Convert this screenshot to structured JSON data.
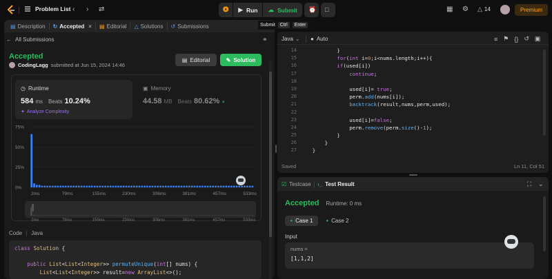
{
  "topbar": {
    "problem_list": "Problem List",
    "run": "Run",
    "submit": "Submit",
    "streak": "14",
    "premium": "Premium",
    "tooltip": {
      "label": "Submit",
      "key1": "Ctrl",
      "key2": "Enter"
    }
  },
  "tabs": [
    {
      "label": "Description"
    },
    {
      "label": "Accepted"
    },
    {
      "label": "Editorial"
    },
    {
      "label": "Solutions"
    },
    {
      "label": "Submissions"
    }
  ],
  "submission": {
    "back_label": "All Submissions",
    "status": "Accepted",
    "user": "CodingLagg",
    "submitted_text": "submitted at Jun 15, 2024 14:46",
    "editorial_btn": "Editorial",
    "solution_btn": "Solution"
  },
  "runtime": {
    "title": "Runtime",
    "value": "584",
    "unit": "ms",
    "beats_label": "Beats",
    "beats_value": "10.24%",
    "analyze": "Analyze Complexity"
  },
  "memory": {
    "title": "Memory",
    "value": "44.58",
    "unit": "MB",
    "beats_label": "Beats",
    "beats_value": "80.62%"
  },
  "chart_data": {
    "type": "bar",
    "ytick_labels": [
      "75%",
      "50%",
      "25%",
      "0%"
    ],
    "yticks": [
      75,
      50,
      25,
      0
    ],
    "ylim": [
      0,
      75
    ],
    "xtick_labels": [
      "2ms",
      "79ms",
      "155ms",
      "230ms",
      "306ms",
      "381ms",
      "457ms",
      "533ms"
    ],
    "xlim": [
      0,
      560
    ],
    "values": [
      66,
      5,
      3,
      3,
      2,
      2,
      2,
      2,
      2,
      2,
      2,
      2,
      2,
      2,
      2,
      2,
      2,
      2,
      2,
      2,
      2,
      2,
      2,
      2,
      2,
      2,
      2,
      2,
      2,
      2,
      2,
      2,
      2,
      2,
      2,
      2,
      2,
      2,
      2,
      2,
      2,
      2,
      2,
      2,
      2,
      2,
      2,
      2,
      2,
      2,
      2,
      2,
      2,
      2,
      2,
      2,
      2,
      2,
      2,
      2,
      2,
      2,
      2,
      2,
      2,
      2,
      2,
      2,
      2,
      2,
      2,
      2,
      2,
      2,
      2,
      2,
      2,
      2,
      2,
      2,
      2,
      2,
      2,
      2,
      2
    ],
    "colors": {
      "bar": "#3b82f6",
      "highlight": "#60a5fa"
    },
    "grid": true
  },
  "left_code": {
    "header_label": "Code",
    "lang": "Java",
    "lines": [
      [
        [
          "class ",
          "kw"
        ],
        [
          "Solution ",
          "ty"
        ],
        [
          "{",
          "id"
        ]
      ],
      [
        [
          "",
          "id"
        ]
      ],
      [
        [
          "    public ",
          "kw"
        ],
        [
          "List",
          "ty"
        ],
        [
          "<",
          "id"
        ],
        [
          "List",
          "ty"
        ],
        [
          "<",
          "id"
        ],
        [
          "Integer",
          "ty"
        ],
        [
          ">> ",
          "id"
        ],
        [
          "permuteUnique",
          "fn"
        ],
        [
          "(",
          "id"
        ],
        [
          "int",
          "kw"
        ],
        [
          "[] nums) {",
          "id"
        ]
      ],
      [
        [
          "        List",
          "ty"
        ],
        [
          "<",
          "id"
        ],
        [
          "List",
          "ty"
        ],
        [
          "<",
          "id"
        ],
        [
          "Integer",
          "ty"
        ],
        [
          ">> result=",
          "id"
        ],
        [
          "new ",
          "kw"
        ],
        [
          "ArrayList",
          "ty"
        ],
        [
          "<>();",
          "id"
        ]
      ]
    ]
  },
  "editor": {
    "lang": "Java",
    "auto": "Auto",
    "status": "Saved",
    "cursor": "Ln 11, Col 51",
    "line_numbers": [
      "14",
      "15",
      "16",
      "17",
      "18",
      "19",
      "20",
      "21",
      "22",
      "23",
      "24",
      "25",
      "26",
      "27"
    ],
    "lines": [
      [
        [
          "            }",
          "id"
        ]
      ],
      [
        [
          "            ",
          "id"
        ],
        [
          "for",
          "kw"
        ],
        [
          "(",
          "id"
        ],
        [
          "int ",
          "kw"
        ],
        [
          "i=",
          "id"
        ],
        [
          "0",
          "nm"
        ],
        [
          ";i<nums.",
          "id"
        ],
        [
          "length",
          "id"
        ],
        [
          ";i++){",
          "id"
        ]
      ],
      [
        [
          "            ",
          "id"
        ],
        [
          "if",
          "kw"
        ],
        [
          "(used[i])",
          "id"
        ]
      ],
      [
        [
          "                ",
          "id"
        ],
        [
          "continue",
          "kw"
        ],
        [
          ";",
          "id"
        ]
      ],
      [
        [
          "",
          "id"
        ]
      ],
      [
        [
          "                used[i]= ",
          "id"
        ],
        [
          "true",
          "kw"
        ],
        [
          ";",
          "id"
        ]
      ],
      [
        [
          "                perm.",
          "id"
        ],
        [
          "add",
          "fn"
        ],
        [
          "(nums[i]);",
          "id"
        ]
      ],
      [
        [
          "                ",
          "id"
        ],
        [
          "backtrack",
          "fn"
        ],
        [
          "(result,nums,perm,used);",
          "id"
        ]
      ],
      [
        [
          "",
          "id"
        ]
      ],
      [
        [
          "                used[i]=",
          "id"
        ],
        [
          "false",
          "kw"
        ],
        [
          ";",
          "id"
        ]
      ],
      [
        [
          "                perm.",
          "id"
        ],
        [
          "remove",
          "fn"
        ],
        [
          "(perm.",
          "id"
        ],
        [
          "size",
          "fn"
        ],
        [
          "()-",
          "id"
        ],
        [
          "1",
          "nm"
        ],
        [
          ");",
          "id"
        ]
      ],
      [
        [
          "            }",
          "id"
        ]
      ],
      [
        [
          "        }",
          "id"
        ]
      ],
      [
        [
          "    }",
          "id"
        ]
      ]
    ]
  },
  "testpanel": {
    "tab_testcase": "Testcase",
    "tab_result": "Test Result",
    "status": "Accepted",
    "runtime": "Runtime: 0 ms",
    "case1": "Case 1",
    "case2": "Case 2",
    "input_label": "Input",
    "var_label": "nums =",
    "var_value": "[1,1,2]"
  }
}
